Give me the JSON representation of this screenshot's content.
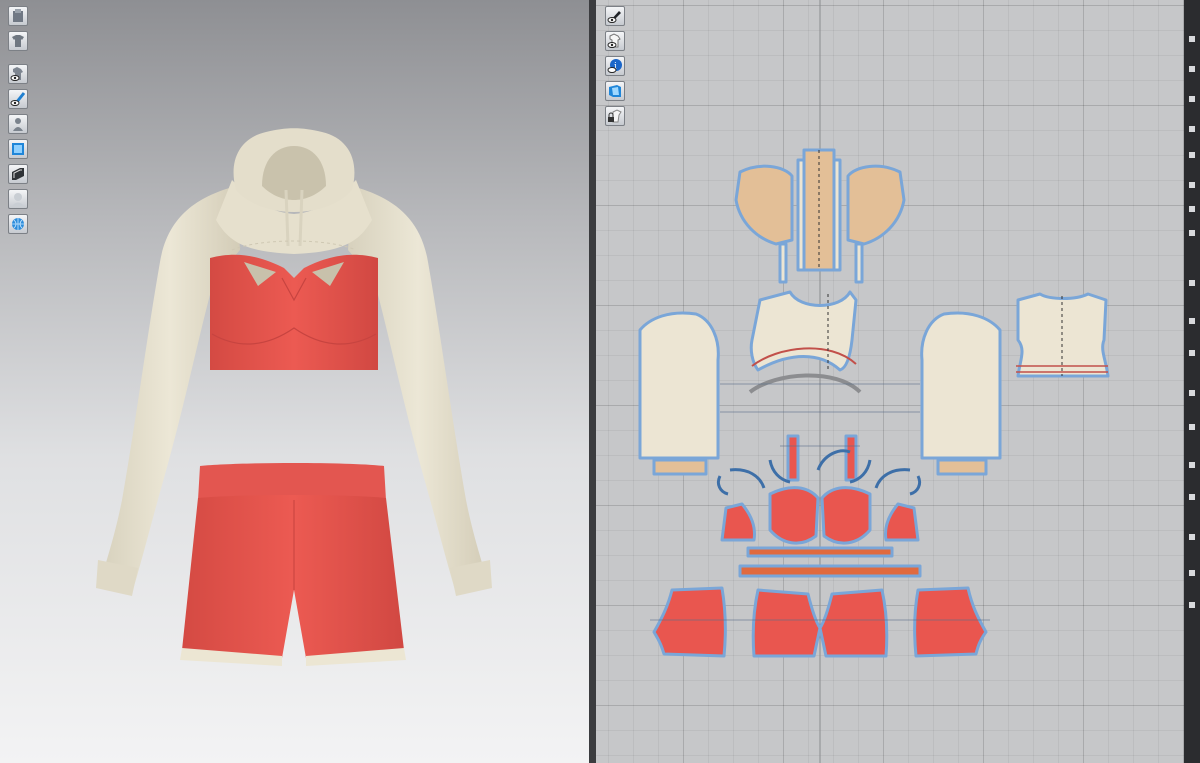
{
  "app": {
    "panels": [
      "3d-garment-window",
      "2d-pattern-window"
    ]
  },
  "toolbar_3d": {
    "icons": [
      "avatar-display-icon",
      "garment-display-icon",
      "show-garment-icon",
      "show-brush-icon",
      "show-avatar-icon",
      "texture-view-icon",
      "shaded-view-icon",
      "avatar-silhouette-icon",
      "wireframe-globe-icon"
    ]
  },
  "toolbar_2d": {
    "icons": [
      "pen-tool-icon",
      "show-garment-2d-icon",
      "info-icon",
      "texture-2d-icon",
      "lock-icon"
    ]
  },
  "garment": {
    "colors": {
      "hoodie": "#ebe6d4",
      "hoodie_shade": "#cfc8b3",
      "bra_and_shorts": "#e8574f",
      "bra_shade": "#c84540",
      "trim": "#efe8d6",
      "pocket_lining": "#e5c39f"
    }
  },
  "pattern": {
    "colors": {
      "piece_beige": "#ece5d3",
      "piece_tan": "#e3bf97",
      "piece_red": "#e9564f",
      "piece_band": "#e06a3f",
      "outline_blue": "#7aa6d8",
      "seam_red": "#c2504a",
      "grid_bg": "#c6c7c9"
    }
  }
}
